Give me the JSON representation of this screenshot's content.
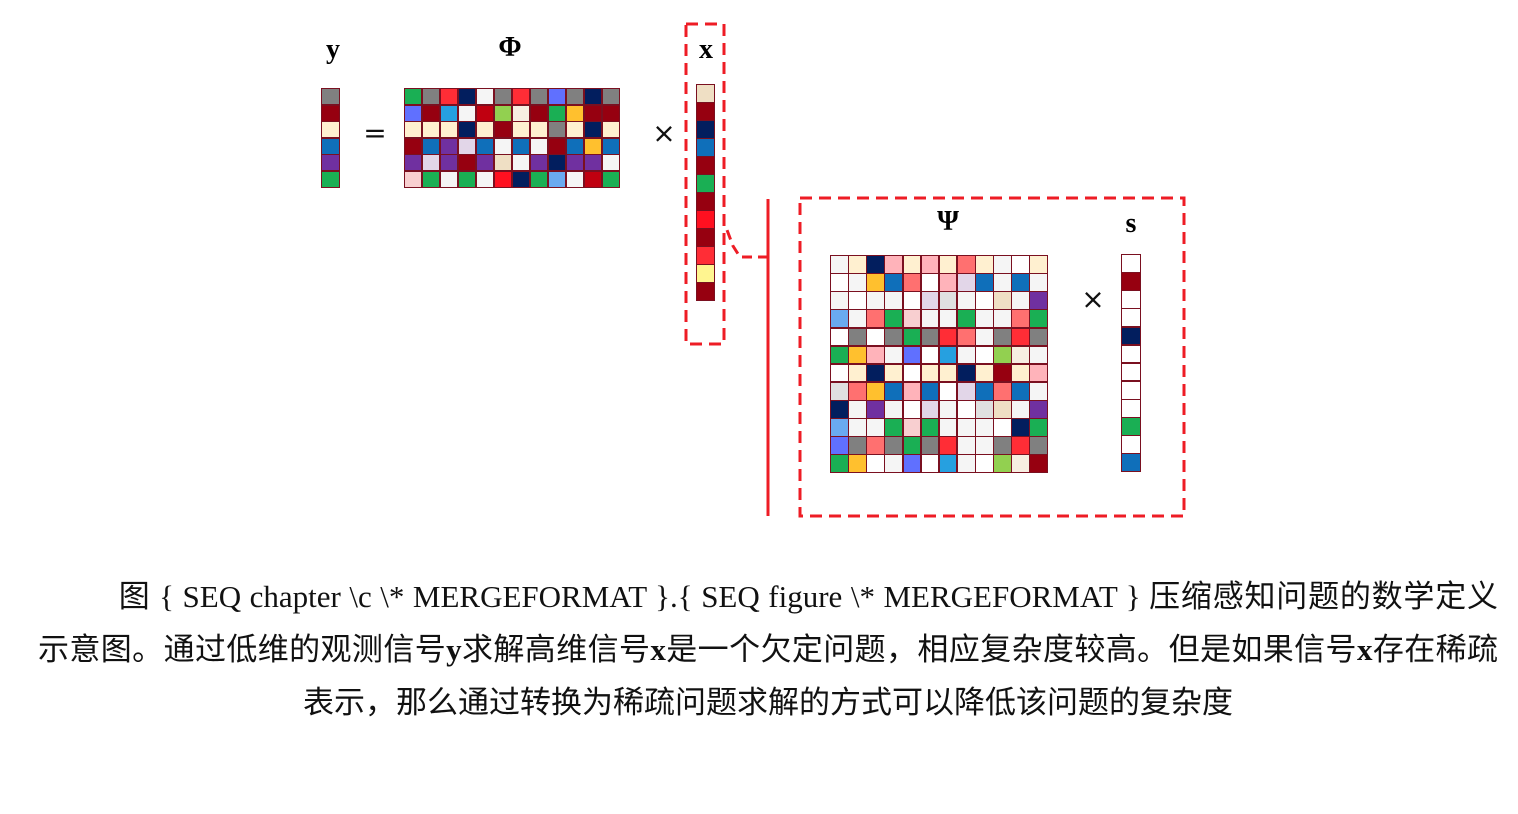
{
  "labels": {
    "y": "y",
    "phi": "Φ",
    "x": "x",
    "psi": "Ψ",
    "s": "s",
    "equals": "=",
    "times1": "×",
    "times2": "×"
  },
  "palette": {
    "G": "#1aaf54",
    "g": "#808080",
    "R": "#ff2d36",
    "N": "#021e5e",
    "W": "#f5f5f5",
    "w": "#ffffff",
    "B": "#6070ff",
    "D": "#960010",
    "C": "#26a0e0",
    "L": "#92d050",
    "E": "#f7eee2",
    "Y": "#ffc02e",
    "K": "#fff0d0",
    "U": "#0f6fba",
    "P": "#7030a0",
    "Q": "#e2d6e8",
    "T": "#efdfc4",
    "p": "#f8cfd0",
    "r": "#c00010",
    "S": "#6aaaf0",
    "s": "#ff7070",
    "k": "#ffb3ba",
    "e": "#e0e0e0",
    "y": "#fff590",
    "F": "#ff1020"
  },
  "accent_color": "#ee1c25",
  "matrices": {
    "y": [
      "g",
      "D",
      "K",
      "U",
      "P",
      "G"
    ],
    "phi": [
      "GgRNWgRgBgNg",
      "BDCWrLEDGYDD",
      "KKKNKDKKgKNK",
      "DUPQUWUWDUYU",
      "PQPDPTWPNPPW",
      "pGWGWFNGSWrG"
    ],
    "x": [
      "T",
      "D",
      "N",
      "U",
      "D",
      "G",
      "D",
      "F",
      "D",
      "R",
      "y",
      "D"
    ],
    "psi": [
      "WKNkKkKsKWwK",
      "wWYUswkQUWUW",
      "WwWWwQeWwTWP",
      "SWsGpWWGWWsG",
      "wgwgGgRsWgRg",
      "GYkWBwCWwLEW",
      "wKNKwKKNKDKk",
      "esYUkUwQUsUW",
      "NWPWwQWweTWP",
      "SWWGpGWWWwNG",
      "BgsgGgRWWgRg",
      "GYwWBwCWwLED"
    ],
    "s": [
      "w",
      "D",
      "w",
      "w",
      "N",
      "w",
      "w",
      "w",
      "w",
      "G",
      "w",
      "U"
    ]
  },
  "caption": {
    "line1": "图 { SEQ chapter \\c \\* MERGEFORMAT }.{ SEQ figure \\* MERGEFORMAT } 压缩感知问题的数学定义示意图。通过低维的观测信号",
    "var_y": "y",
    "part2": "求解高维信号",
    "var_x": "x",
    "part3": "是一个欠定问题，相应复杂度较高。但是如果信号",
    "var_x2": "x",
    "part4": "存在稀疏表示，那么通过转换为稀疏问题求解的方式可以降低该问题的复杂度"
  }
}
